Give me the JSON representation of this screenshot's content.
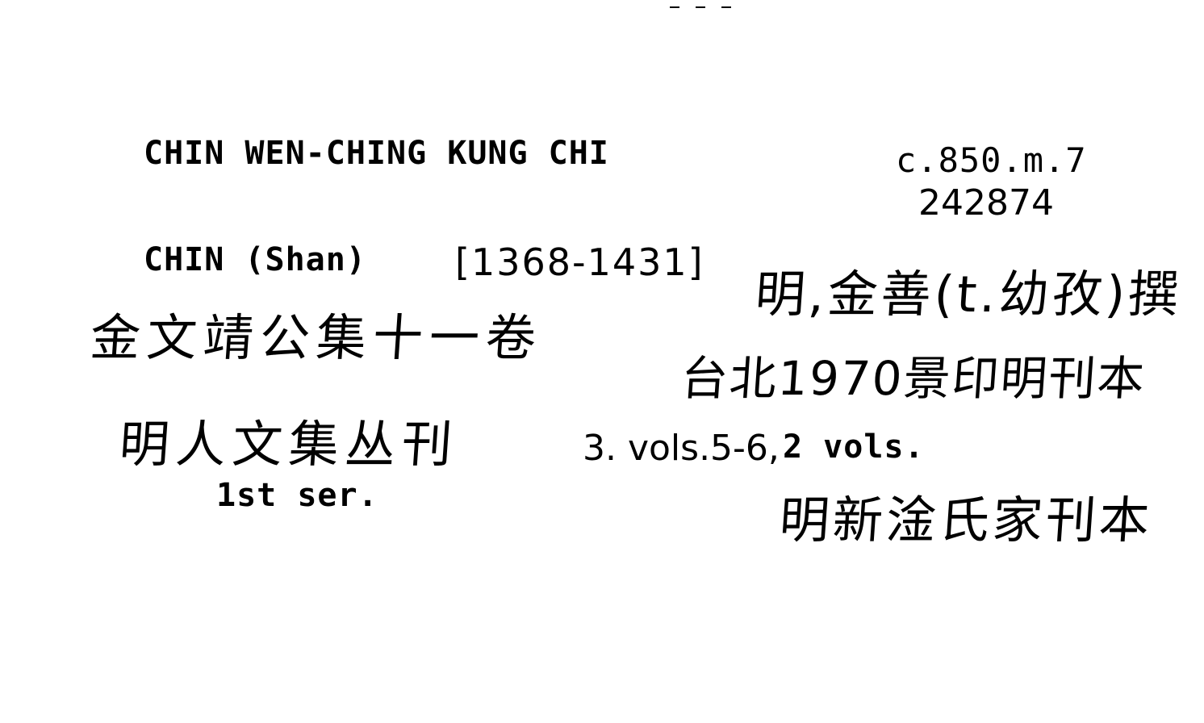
{
  "card": {
    "title": "CHIN WEN-CHING KUNG CHI",
    "shelfmark": "c.850.m.7",
    "accession_number": "242874",
    "author": "CHIN (Shan)",
    "author_dates": "[1368-1431]",
    "handwritten_title_cjk": "金文靖公集十一卷",
    "handwritten_series_cjk": "明人文集丛刊",
    "series_note": "1st ser.",
    "handwritten_author_cjk": "明,金善(t.幼孜)撰",
    "handwritten_imprint_cjk": "台北1970景印明刊本",
    "volumes_handwritten_part": "3. vols.5-6,",
    "volumes_typed_part": "2 vols.",
    "handwritten_edition_cjk": "明新淦氏家刊本"
  }
}
